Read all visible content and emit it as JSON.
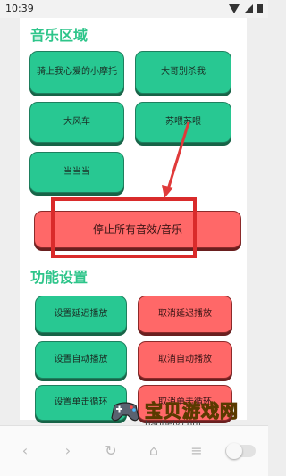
{
  "status_bar": {
    "time": "10:39",
    "icons": [
      "wifi-icon",
      "signal-icon",
      "battery-icon"
    ]
  },
  "music_section": {
    "title": "音乐区域",
    "buttons": [
      {
        "label": "骑上我心爱的小摩托"
      },
      {
        "label": "大哥别杀我"
      },
      {
        "label": "大风车"
      },
      {
        "label": "苏喂苏喂"
      },
      {
        "label": "当当当"
      }
    ],
    "stop_button": "停止所有音效/音乐"
  },
  "settings_section": {
    "title": "功能设置",
    "buttons": [
      {
        "label": "设置延迟播放"
      },
      {
        "label": "取消延迟播放"
      },
      {
        "label": "设置自动播放"
      },
      {
        "label": "取消自动播放"
      },
      {
        "label": "设置单击循环"
      },
      {
        "label": "取消单击循环"
      }
    ]
  },
  "watermark": {
    "text": "宝贝游戏网",
    "url": "baobeiy.com"
  },
  "colors": {
    "accent_green": "#2ec58a",
    "button_green": "#28c892",
    "button_red": "#ff6868",
    "annotation_red": "#d92b2b",
    "page_bg": "#ffffff"
  },
  "nav_bar": {
    "icons": [
      "back-icon",
      "forward-icon",
      "reload-icon",
      "home-icon",
      "menu-icon",
      "toggle-switch"
    ]
  }
}
